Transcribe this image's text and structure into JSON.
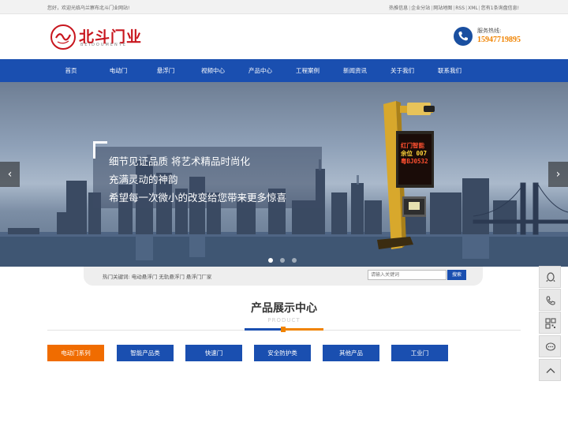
{
  "topbar": {
    "welcome": "您好，欢迎光临乌兰察布北斗门业网站!",
    "links": [
      "热推信息",
      "企业分站",
      "网站地图",
      "RSS",
      "XML",
      "您有1条询盘信息!"
    ]
  },
  "header": {
    "logo_cn": "北斗门业",
    "logo_en": "BEIDOUMENYE",
    "hotline_label": "服务热线:",
    "hotline_number": "15947719895"
  },
  "nav": {
    "items": [
      "首页",
      "电动门",
      "悬浮门",
      "视频中心",
      "产品中心",
      "工程案例",
      "新闻资讯",
      "关于我们",
      "联系我们"
    ]
  },
  "banner": {
    "slogan": [
      "细节见证品质 将艺术精品时尚化",
      "充满灵动的神韵",
      "希望每一次微小的改变给您带来更多惊喜"
    ],
    "sign_lines": [
      "红门智能",
      "余位 007",
      "粤BJ0532"
    ],
    "prev_arrow": "‹",
    "next_arrow": "›",
    "slide_count": 3,
    "active_slide": 1
  },
  "search": {
    "hot_keywords_label": "热门关键词:",
    "hot_keywords": "电动悬浮门  无轨悬浮门  悬浮门厂家",
    "placeholder": "请输入关键词",
    "button": "搜索"
  },
  "section": {
    "title": "产品展示中心",
    "subtitle": "PRODUCT"
  },
  "categories": {
    "items": [
      "电动门系列",
      "智能产品类",
      "快速门",
      "安全防护类",
      "其他产品",
      "工业门"
    ],
    "active_index": 0
  },
  "side_tools": [
    "qq-icon",
    "phone-icon",
    "qrcode-icon",
    "message-icon",
    "back-to-top-icon"
  ],
  "colors": {
    "brand_blue": "#1a4fb0",
    "accent_orange": "#f06c00",
    "logo_red": "#c8161e",
    "hotline_orange": "#f08300"
  }
}
